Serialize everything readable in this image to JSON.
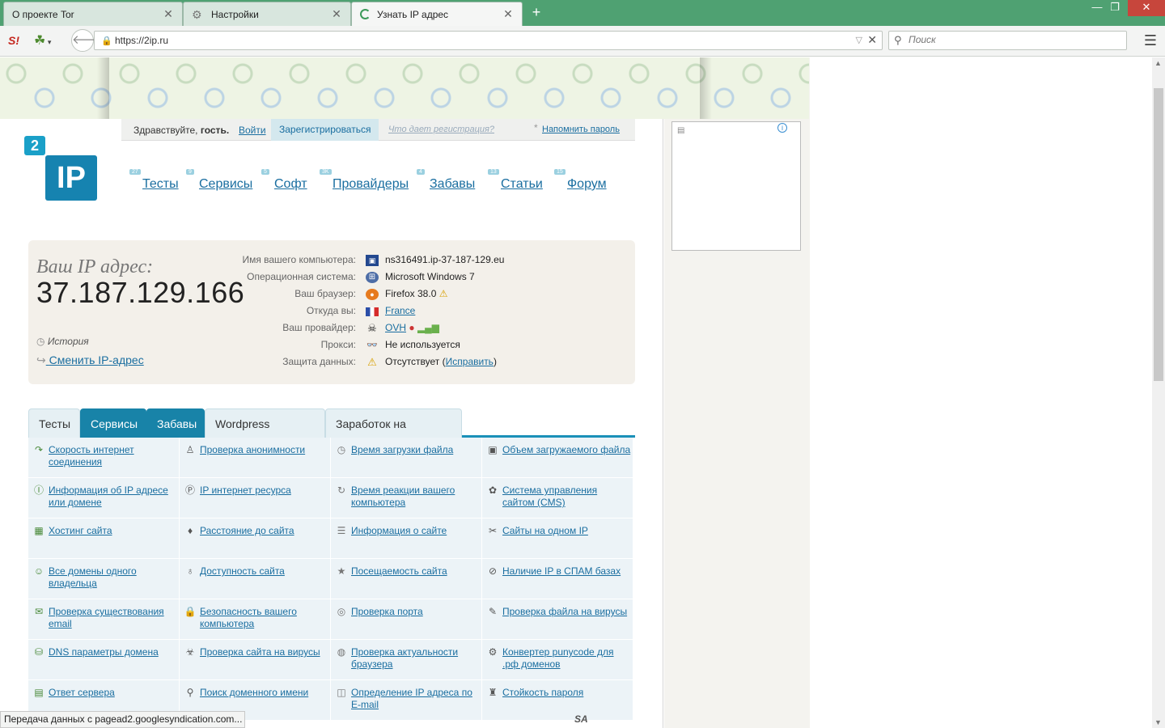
{
  "browser": {
    "tabs": [
      {
        "title": "О проекте Tor",
        "active": false
      },
      {
        "title": "Настройки",
        "active": false
      },
      {
        "title": "Узнать IP адрес",
        "active": true
      }
    ],
    "new_tab": "+",
    "window_buttons": {
      "minimize": "—",
      "restore": "❐",
      "close": "✕"
    },
    "url": "https://2ip.ru",
    "search_placeholder": "Поиск",
    "extension_s": "S!",
    "menu_icon": "hamburger-icon"
  },
  "login": {
    "greeting_prefix": "Здравствуйте,",
    "greeting_user": "гость.",
    "enter": "Войти",
    "register": "Зарегистрироваться",
    "why": "Что дает регистрация?",
    "asterisk": "*",
    "remind": "Напомнить пароль"
  },
  "logo": {
    "two": "2",
    "ip": "IP"
  },
  "nav": [
    {
      "label": "Тесты",
      "count": "27"
    },
    {
      "label": "Сервисы",
      "count": "9"
    },
    {
      "label": "Софт",
      "count": "5"
    },
    {
      "label": "Провайдеры",
      "count": "3K"
    },
    {
      "label": "Забавы",
      "count": "4"
    },
    {
      "label": "Статьи",
      "count": "13"
    },
    {
      "label": "Форум",
      "count": "15"
    }
  ],
  "ip_block": {
    "label": "Ваш IP адрес:",
    "value": "37.187.129.166",
    "history": "История",
    "change": "Сменить IP-адрес",
    "rows": [
      {
        "label": "Имя вашего компьютера:",
        "value": "ns316491.ip-37-187-129.eu",
        "icon": "monitor-icon"
      },
      {
        "label": "Операционная система:",
        "value": "Microsoft Windows 7",
        "icon": "windows-icon"
      },
      {
        "label": "Ваш браузер:",
        "value": "Firefox 38.0",
        "icon": "firefox-icon",
        "suffix": "⚠"
      },
      {
        "label": "Откуда вы:",
        "link": "France",
        "icon": "flag-icon"
      },
      {
        "label": "Ваш провайдер:",
        "link": "OVH",
        "icon": "provider-icon"
      },
      {
        "label": "Прокси:",
        "value": "Не используется",
        "icon": "glasses-icon"
      },
      {
        "label": "Защита данных:",
        "value": "Отсутствует (",
        "link": "Исправить",
        "after": ")",
        "icon": "warning-icon"
      }
    ]
  },
  "service_tabs": [
    "Тесты",
    "Сервисы",
    "Забавы",
    "Wordpress дизайны",
    "Заработок на трафике"
  ],
  "services": [
    "Скорость интернет соединения",
    "Проверка анонимности",
    "Время загрузки файла",
    "Объем загружаемого файла",
    "Информация об IP адресе или домене",
    "IP интернет ресурса",
    "Время реакции вашего компьютера",
    "Система управления сайтом (CMS)",
    "Хостинг сайта",
    "Расстояние до сайта",
    "Информация о сайте",
    "Сайты на одном IP",
    "Все домены одного владельца",
    "Доступность сайта",
    "Посещаемость сайта",
    "Наличие IP в СПАМ базах",
    "Проверка существования email",
    "Безопасность вашего компьютера",
    "Проверка порта",
    "Проверка файла на вирусы",
    "DNS параметры домена",
    "Проверка сайта на вирусы",
    "Проверка актуальности браузера",
    "Конвертер punycode для .рф доменов",
    "Ответ сервера",
    "Поиск доменного имени",
    "Определение IP адреса по E-mail",
    "Стойкость пароля"
  ],
  "status": "Передача данных с pagead2.googlesyndication.com...",
  "sa_badge": "SA",
  "colors": {
    "tab_bar": "#4fa172",
    "link": "#1a6ea0",
    "tab_active": "#1883a8"
  }
}
